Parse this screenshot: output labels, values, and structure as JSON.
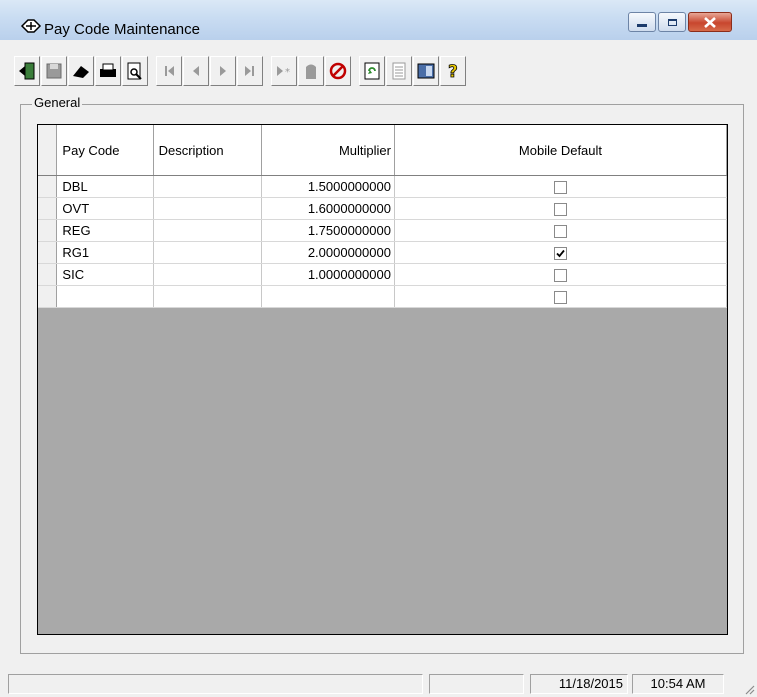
{
  "window": {
    "title": "Pay Code Maintenance"
  },
  "title_buttons": {
    "minimize_icon": "minimize-icon",
    "maximize_icon": "maximize-icon",
    "close_icon": "close-icon"
  },
  "toolbar": {
    "items": [
      {
        "name": "exit-button",
        "icon": "door-exit-icon"
      },
      {
        "name": "save-button",
        "icon": "floppy-disk-icon"
      },
      {
        "name": "open-button",
        "icon": "open-icon"
      },
      {
        "name": "print-button",
        "icon": "printer-icon"
      },
      {
        "name": "print-preview-button",
        "icon": "print-preview-icon"
      },
      {
        "name": "first-record-button",
        "icon": "first-record-icon"
      },
      {
        "name": "previous-record-button",
        "icon": "previous-record-icon"
      },
      {
        "name": "next-record-button",
        "icon": "next-record-icon"
      },
      {
        "name": "last-record-button",
        "icon": "last-record-icon"
      },
      {
        "name": "new-record-button",
        "icon": "new-record-icon"
      },
      {
        "name": "delete-record-button",
        "icon": "delete-record-icon"
      },
      {
        "name": "cancel-button",
        "icon": "cancel-icon"
      },
      {
        "name": "refresh-button",
        "icon": "refresh-icon"
      },
      {
        "name": "notes-button",
        "icon": "notes-icon"
      },
      {
        "name": "lookup-button",
        "icon": "lookup-icon"
      },
      {
        "name": "help-button",
        "icon": "help-icon"
      }
    ]
  },
  "group": {
    "label": "General"
  },
  "grid": {
    "columns": [
      "Pay Code",
      "Description",
      "Multiplier",
      "Mobile Default"
    ],
    "rows": [
      {
        "pay_code": "DBL",
        "description": "",
        "multiplier": "1.5000000000",
        "mobile_default": false
      },
      {
        "pay_code": "OVT",
        "description": "",
        "multiplier": "1.6000000000",
        "mobile_default": false
      },
      {
        "pay_code": "REG",
        "description": "",
        "multiplier": "1.7500000000",
        "mobile_default": false
      },
      {
        "pay_code": "RG1",
        "description": "",
        "multiplier": "2.0000000000",
        "mobile_default": true
      },
      {
        "pay_code": "SIC",
        "description": "",
        "multiplier": "1.0000000000",
        "mobile_default": false
      },
      {
        "pay_code": "",
        "description": "",
        "multiplier": "",
        "mobile_default": false
      }
    ]
  },
  "status": {
    "date": "11/18/2015",
    "time": "10:54 AM"
  },
  "colors": {
    "title_gradient": "#c9dcf2",
    "close_button": "#c8462e",
    "grid_empty": "#a9a9a9"
  }
}
